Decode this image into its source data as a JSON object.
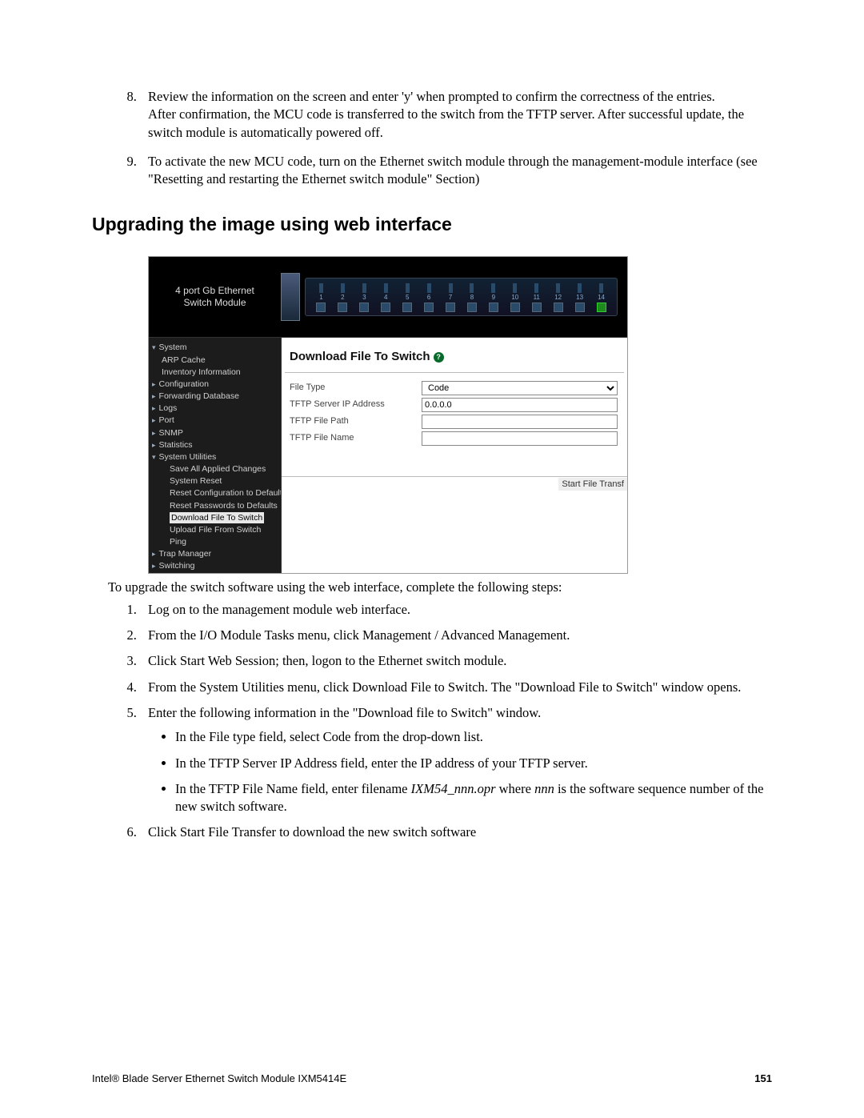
{
  "list1": {
    "step8_a": "Review the information on the screen and enter 'y' when prompted to confirm the correctness of the entries.",
    "step8_b": "After confirmation, the MCU code is transferred to the switch from the TFTP server. After successful update, the switch module is automatically powered off.",
    "step9": "To activate the new MCU code, turn on the Ethernet switch module through the management-module interface (see \"Resetting and restarting the Ethernet switch module\" Section)"
  },
  "heading": "Upgrading the image using web interface",
  "webui": {
    "brand_l1": "4 port Gb Ethernet",
    "brand_l2": "Switch Module",
    "port_numbers": [
      "1",
      "2",
      "3",
      "4",
      "5",
      "6",
      "7",
      "8",
      "9",
      "10",
      "11",
      "12",
      "13",
      "14"
    ],
    "nav": {
      "system": "System",
      "arp": "ARP Cache",
      "inventory": "Inventory Information",
      "configuration": "Configuration",
      "fwd": "Forwarding Database",
      "logs": "Logs",
      "port": "Port",
      "snmp": "SNMP",
      "statistics": "Statistics",
      "sysutil": "System Utilities",
      "save": "Save All Applied Changes",
      "sysreset": "System Reset",
      "resetcfg": "Reset Configuration to Defaults",
      "resetpw": "Reset Passwords to Defaults",
      "dl": "Download File To Switch",
      "ul": "Upload File From Switch",
      "ping": "Ping",
      "trap": "Trap Manager",
      "switching": "Switching"
    },
    "content": {
      "title": "Download File To Switch",
      "file_type_lbl": "File Type",
      "file_type_val": "Code",
      "ip_lbl": "TFTP Server IP Address",
      "ip_val": "0.0.0.0",
      "path_lbl": "TFTP File Path",
      "path_val": "",
      "name_lbl": "TFTP File Name",
      "name_val": "",
      "submit": "Start File Transf"
    }
  },
  "after_fig": "To upgrade the switch software using the web interface, complete the following steps:",
  "list2": {
    "s1": "Log on to the management module web interface.",
    "s2": "From the I/O Module Tasks menu, click Management / Advanced Management.",
    "s3": "Click Start Web Session; then, logon to the Ethernet switch module.",
    "s4": "From the System Utilities menu, click Download File to Switch. The \"Download File to Switch\" window opens.",
    "s5": "Enter the following information in the \"Download file to Switch\" window.",
    "s5b1": "In the File type field, select Code from the drop-down list.",
    "s5b2": "In the TFTP Server IP Address field, enter the IP address of your TFTP server.",
    "s5b3_a": "In the TFTP File Name field, enter filename ",
    "s5b3_fname": "IXM54_nnn.opr",
    "s5b3_b": " where ",
    "s5b3_nnn": "nnn",
    "s5b3_c": " is the software sequence number of the new switch software.",
    "s6": "Click Start File Transfer to download the new switch software"
  },
  "footer": {
    "left": "Intel® Blade Server Ethernet Switch Module IXM5414E",
    "right": "151"
  }
}
